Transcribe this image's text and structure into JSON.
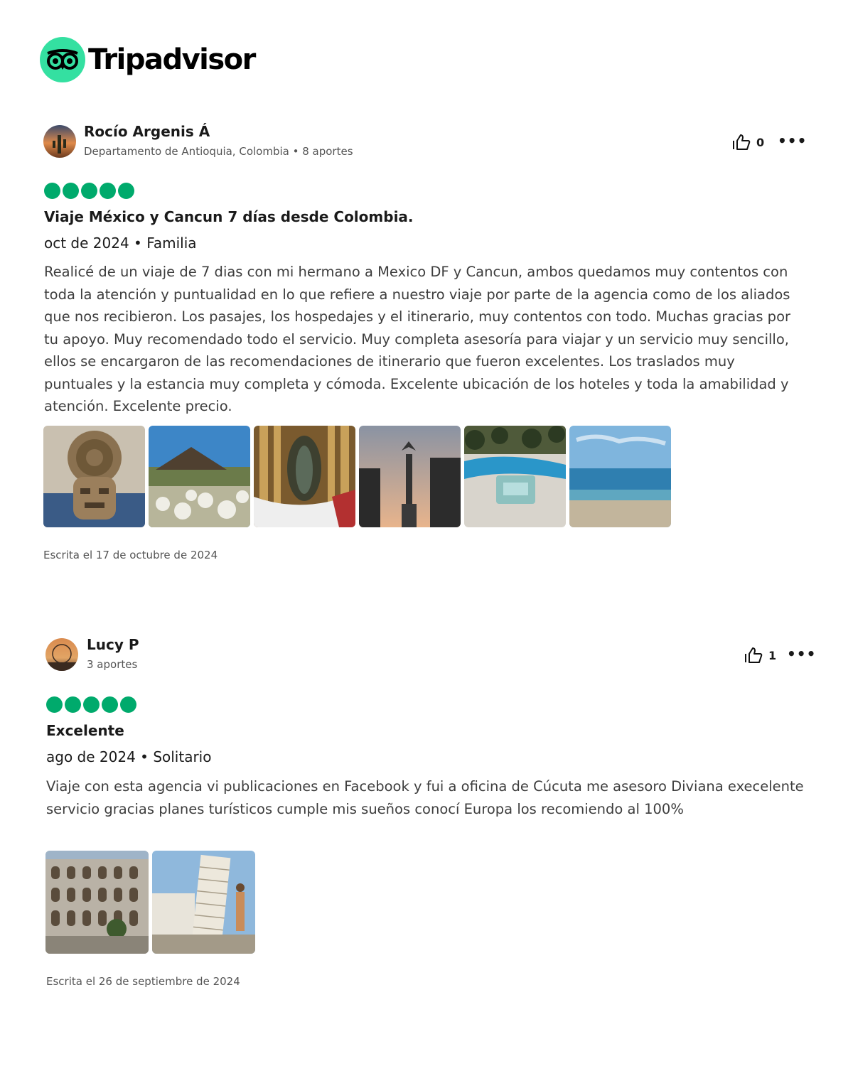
{
  "brand": {
    "name": "Tripadvisor",
    "logo_icon": "owl-eyes-icon",
    "accent": "#34e0a1"
  },
  "reviews": [
    {
      "author": "Rocío Argenis Á",
      "location_contribs": "Departamento de Antioquia, Colombia • 8 aportes",
      "helpful_count": "0",
      "rating": 5,
      "title": "Viaje México y Cancun 7 días desde Colombia.",
      "trip": "oct de 2024 • Familia",
      "body": "Realicé de un viaje de 7 dias con mi hermano a Mexico DF y Cancun, ambos quedamos muy contentos con toda la atención y puntualidad en lo que refiere a nuestro viaje por parte de la agencia como de los aliados que nos recibieron. Los pasajes, los hospedajes y el itinerario, muy contentos con todo. Muchas gracias por tu apoyo. Muy recomendado todo el servicio. Muy completa asesoría para viajar y un servicio muy sencillo, ellos se encargaron de las recomendaciones de itinerario que fueron excelentes. Los traslados muy puntuales y la estancia muy completa y cómoda. Excelente ubicación de los hoteles y toda la amabilidad y atención. Excelente precio.",
      "photos": [
        "aztec-sculpture-photo",
        "pyramid-photo",
        "basilica-photo",
        "angel-monument-photo",
        "resort-pool-photo",
        "beach-photo"
      ],
      "written": "Escrita el 17 de octubre de 2024"
    },
    {
      "author": "Lucy P",
      "location_contribs": "3 aportes",
      "helpful_count": "1",
      "rating": 5,
      "title": "Excelente",
      "trip": "ago de 2024 • Solitario",
      "body": "Viaje con esta agencia vi publicaciones en Facebook y fui a oficina de Cúcuta me asesoro Diviana execelente servicio gracias planes turísticos cumple mis sueños conocí Europa los recomiendo al 100%",
      "photos": [
        "colosseum-photo",
        "pisa-tower-photo"
      ],
      "written": "Escrita el 26 de septiembre de 2024"
    }
  ]
}
